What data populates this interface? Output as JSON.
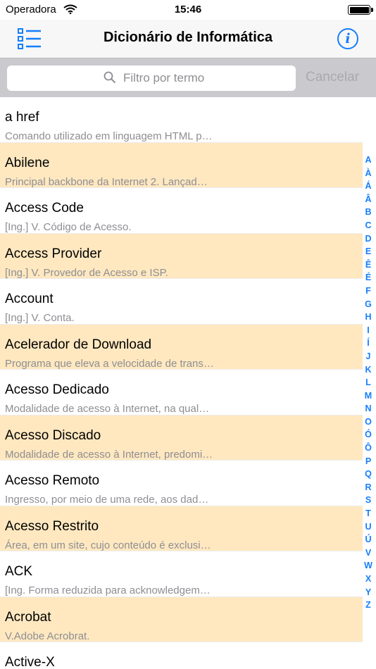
{
  "status_bar": {
    "carrier": "Operadora",
    "time": "15:46"
  },
  "nav": {
    "title": "Dicionário de Informática",
    "info_label": "i"
  },
  "search": {
    "placeholder": "Filtro por termo",
    "cancel_label": "Cancelar"
  },
  "colors": {
    "accent": "#157efb",
    "highlight": "#ffe8c0",
    "secondary_text": "#8e8e93"
  },
  "entries": [
    {
      "term": "a href",
      "desc": "Comando utilizado em linguagem HTML p…",
      "highlight": false
    },
    {
      "term": "Abilene",
      "desc": "Principal backbone da Internet 2. Lançad…",
      "highlight": true
    },
    {
      "term": "Access Code",
      "desc": "[Ing.] V. Código de Acesso.",
      "highlight": false
    },
    {
      "term": "Access Provider",
      "desc": "[Ing.] V. Provedor de Acesso e ISP.",
      "highlight": true
    },
    {
      "term": "Account",
      "desc": "[Ing.] V. Conta.",
      "highlight": false
    },
    {
      "term": "Acelerador de Download",
      "desc": "Programa que eleva a velocidade de trans…",
      "highlight": true
    },
    {
      "term": "Acesso Dedicado",
      "desc": "Modalidade de acesso à Internet, na qual…",
      "highlight": false
    },
    {
      "term": "Acesso Discado",
      "desc": "Modalidade de acesso à Internet, predomi…",
      "highlight": true
    },
    {
      "term": "Acesso Remoto",
      "desc": "Ingresso, por meio de uma rede, aos dad…",
      "highlight": false
    },
    {
      "term": "Acesso Restrito",
      "desc": "Área, em um site, cujo conteúdo é exclusi…",
      "highlight": true
    },
    {
      "term": "ACK",
      "desc": "[Ing. Forma reduzida para acknowledgem…",
      "highlight": false
    },
    {
      "term": "Acrobat",
      "desc": "V.Adobe Acrobrat.",
      "highlight": true
    },
    {
      "term": "Active-X",
      "desc": "",
      "highlight": false
    }
  ],
  "index_letters": [
    "A",
    "À",
    "Á",
    "Â",
    "B",
    "C",
    "D",
    "E",
    "Ê",
    "É",
    "F",
    "G",
    "H",
    "I",
    "Í",
    "J",
    "K",
    "L",
    "M",
    "N",
    "O",
    "Ó",
    "Ô",
    "P",
    "Q",
    "R",
    "S",
    "T",
    "U",
    "Ú",
    "V",
    "W",
    "X",
    "Y",
    "Z"
  ]
}
